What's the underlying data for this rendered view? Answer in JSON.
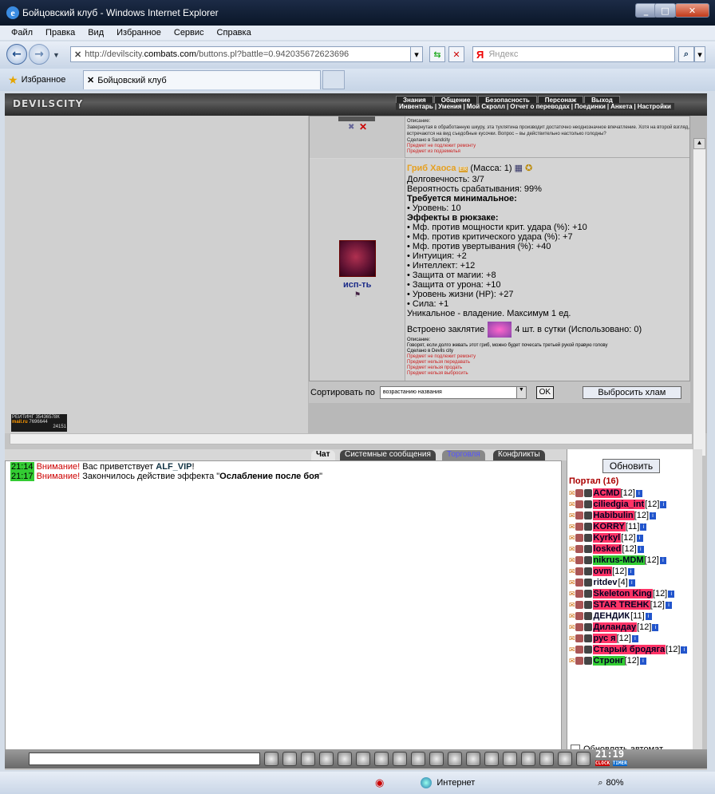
{
  "window": {
    "title": "Бойцовский клуб - Windows Internet Explorer",
    "min": "_",
    "max": "□",
    "close": "✕"
  },
  "menu": [
    "Файл",
    "Правка",
    "Вид",
    "Избранное",
    "Сервис",
    "Справка"
  ],
  "address": {
    "prefix": "http://devilscity.",
    "domain": "combats.com",
    "suffix": "/buttons.pl?battle=0.942035672623696"
  },
  "search": {
    "logo": "Я",
    "placeholder": "Яндекс"
  },
  "favorites": {
    "label": "Избранное"
  },
  "tab": {
    "label": "Бойцовский клуб"
  },
  "game": {
    "logo": "DEVILSCITY",
    "nav_top": [
      "Знания",
      "Общение",
      "Безопасность",
      "Персонаж",
      "Выход"
    ],
    "nav_bottom": [
      "Инвентарь",
      "Умения",
      "Мой Скролл",
      "Отчет о переводах",
      "Поединки",
      "Анкета",
      "Настройки"
    ],
    "rating": {
      "title": "РЕЙТИНГ",
      "num1": "35436578К",
      "brand": "mail.ru",
      "num2": "7696644",
      "num3": "24151"
    }
  },
  "item1": {
    "desc_title": "Описание:",
    "desc": "Завернутая в обработанную шкуру, эта тухлятина производит достаточно неоднозначное впечатление. Хотя на второй взгляд, встречаются на вид съедобные кусочки. Вопрос – вы действительно настолько голодны?",
    "made": "Сделано в Sandcity",
    "notes": [
      "Предмет не подлежит ремонту",
      "Предмет из подземелья"
    ]
  },
  "item2": {
    "name": "Гриб Хаоса",
    "mass": "(Масса: 1)",
    "action": "исп-ть",
    "durability": "Долговечность: 3/7",
    "chance": "Вероятность срабатывания: 99%",
    "req_title": "Требуется минимальное:",
    "req": [
      "• Уровень: 10"
    ],
    "eff_title": "Эффекты в рюкзаке:",
    "effects": [
      "• Мф. против мощности крит. удара (%): +10",
      "• Мф. против критического удара (%): +7",
      "• Мф. против увертывания (%): +40",
      "• Интуиция: +2",
      "• Интеллект: +12",
      "• Защита от магии: +8",
      "• Защита от урона: +10",
      "• Уровень жизни (HP): +27",
      "• Сила: +1"
    ],
    "unique": "Уникальное - владение. Максимум 1 ед.",
    "spell_label": "Встроено заклятие",
    "spell_count": "4 шт. в сутки (Использовано: 0)",
    "desc_title": "Описание:",
    "desc": "Говорят, если долго жевать этот гриб, можно будет почесать третьей рукой правую голову",
    "made": "Сделано в Devils city",
    "notes": [
      "Предмет не подлежит ремонту",
      "Предмет нельзя передавать",
      "Предмет нельзя продать",
      "Предмет нельзя выбросить"
    ]
  },
  "sort": {
    "label": "Сортировать по",
    "value": "возрастанию названия",
    "ok": "OK",
    "drop": "Выбросить хлам"
  },
  "chat_tabs": [
    "Чат",
    "Системные сообщения",
    "Торговля",
    "Конфликты"
  ],
  "chat": [
    {
      "time": "21:14",
      "warn": "Внимание!",
      "text": " Вас приветствует ",
      "bold": "ALF_VIP",
      "tail": "!"
    },
    {
      "time": "21:17",
      "warn": "Внимание!",
      "text": " Закончилось действие эффекта \"",
      "bold": "Ослабление после боя",
      "tail": "\""
    }
  ],
  "users": {
    "refresh": "Обновить",
    "portal": "Портал (16)",
    "list": [
      {
        "name": "ACMD",
        "lvl": "[12]",
        "style": "pink"
      },
      {
        "name": "ciliedgia_int",
        "lvl": "[12]",
        "style": "pink"
      },
      {
        "name": "Habibulin",
        "lvl": "[12]",
        "style": "pink"
      },
      {
        "name": "KORRY",
        "lvl": "[11]",
        "style": "pink"
      },
      {
        "name": "Kyrkyl",
        "lvl": "[12]",
        "style": "pink"
      },
      {
        "name": "losked",
        "lvl": "[12]",
        "style": "pink"
      },
      {
        "name": "nikrus-MDM",
        "lvl": "[12]",
        "style": "green"
      },
      {
        "name": "ovm",
        "lvl": "[12]",
        "style": "pink"
      },
      {
        "name": "ritdev",
        "lvl": "[4]",
        "style": "plain"
      },
      {
        "name": "Skeleton King",
        "lvl": "[12]",
        "style": "pink"
      },
      {
        "name": "STAR TREHK",
        "lvl": "[12]",
        "style": "pink"
      },
      {
        "name": "ДЕНДИК",
        "lvl": "[11]",
        "style": "plain"
      },
      {
        "name": "Диландау",
        "lvl": "[12]",
        "style": "pink"
      },
      {
        "name": "рус я",
        "lvl": "[12]",
        "style": "pink"
      },
      {
        "name": "Старый бродяга",
        "lvl": "[12]",
        "style": "pink"
      },
      {
        "name": "Стронг",
        "lvl": "[12]",
        "style": "green"
      }
    ],
    "auto": "Обновлять автомат."
  },
  "clock": {
    "time": "21:19",
    "clock_label": "CLOCK",
    "timer_label": "TIMER"
  },
  "status": {
    "zone": "Интернет",
    "zoom": "80%"
  }
}
